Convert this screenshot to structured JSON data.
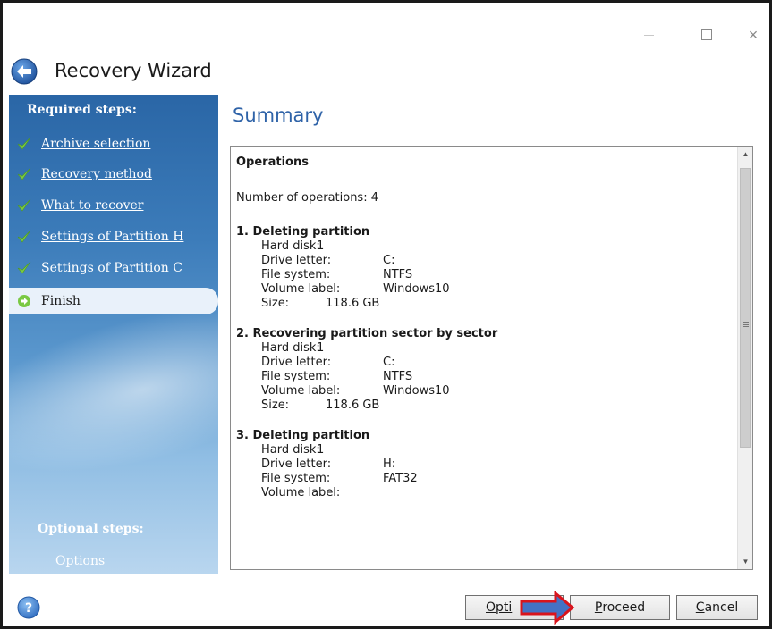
{
  "window": {
    "title": "Recovery Wizard",
    "caption_close": "×"
  },
  "sidebar": {
    "required_heading": "Required steps:",
    "steps": [
      {
        "label": "Archive selection",
        "done": true
      },
      {
        "label": "Recovery method",
        "done": true
      },
      {
        "label": "What to recover",
        "done": true
      },
      {
        "label": "Settings of Partition H",
        "done": true
      },
      {
        "label": "Settings of Partition C",
        "done": true
      }
    ],
    "current_step": "Finish",
    "optional_heading": "Optional steps:",
    "optional_link": "Options"
  },
  "summary": {
    "title": "Summary",
    "operations_header": "Operations",
    "count_text": "Number of operations: 4",
    "keys": {
      "hard_disk": "Hard disk:",
      "drive_letter": "Drive letter:",
      "file_system": "File system:",
      "volume_label": "Volume label:",
      "size": "Size:"
    },
    "operations": [
      {
        "title": "1. Deleting partition",
        "hard_disk": "1",
        "drive_letter": "C:",
        "file_system": "NTFS",
        "volume_label": "Windows10",
        "size": "118.6 GB"
      },
      {
        "title": "2. Recovering partition sector by sector",
        "hard_disk": "1",
        "drive_letter": "C:",
        "file_system": "NTFS",
        "volume_label": "Windows10",
        "size": "118.6 GB"
      },
      {
        "title": "3. Deleting partition",
        "hard_disk": "1",
        "drive_letter": "H:",
        "file_system": "FAT32",
        "volume_label": ""
      }
    ]
  },
  "buttons": {
    "options_label": "Opti",
    "proceed_label": "Proceed",
    "proceed_mnemonic": "P",
    "proceed_rest": "roceed",
    "cancel_mnemonic": "C",
    "cancel_rest": "ancel"
  },
  "colors": {
    "accent_title": "#2f63a8",
    "sidebar_top": "#2a66a6",
    "check_green": "#7ac943",
    "annotation_red": "#d9141c",
    "annotation_blue": "#4472c4"
  },
  "icons": {
    "back": "back-arrow-icon",
    "step_done": "checkmark-icon",
    "step_current": "arrow-right-icon",
    "help": "help-icon"
  }
}
